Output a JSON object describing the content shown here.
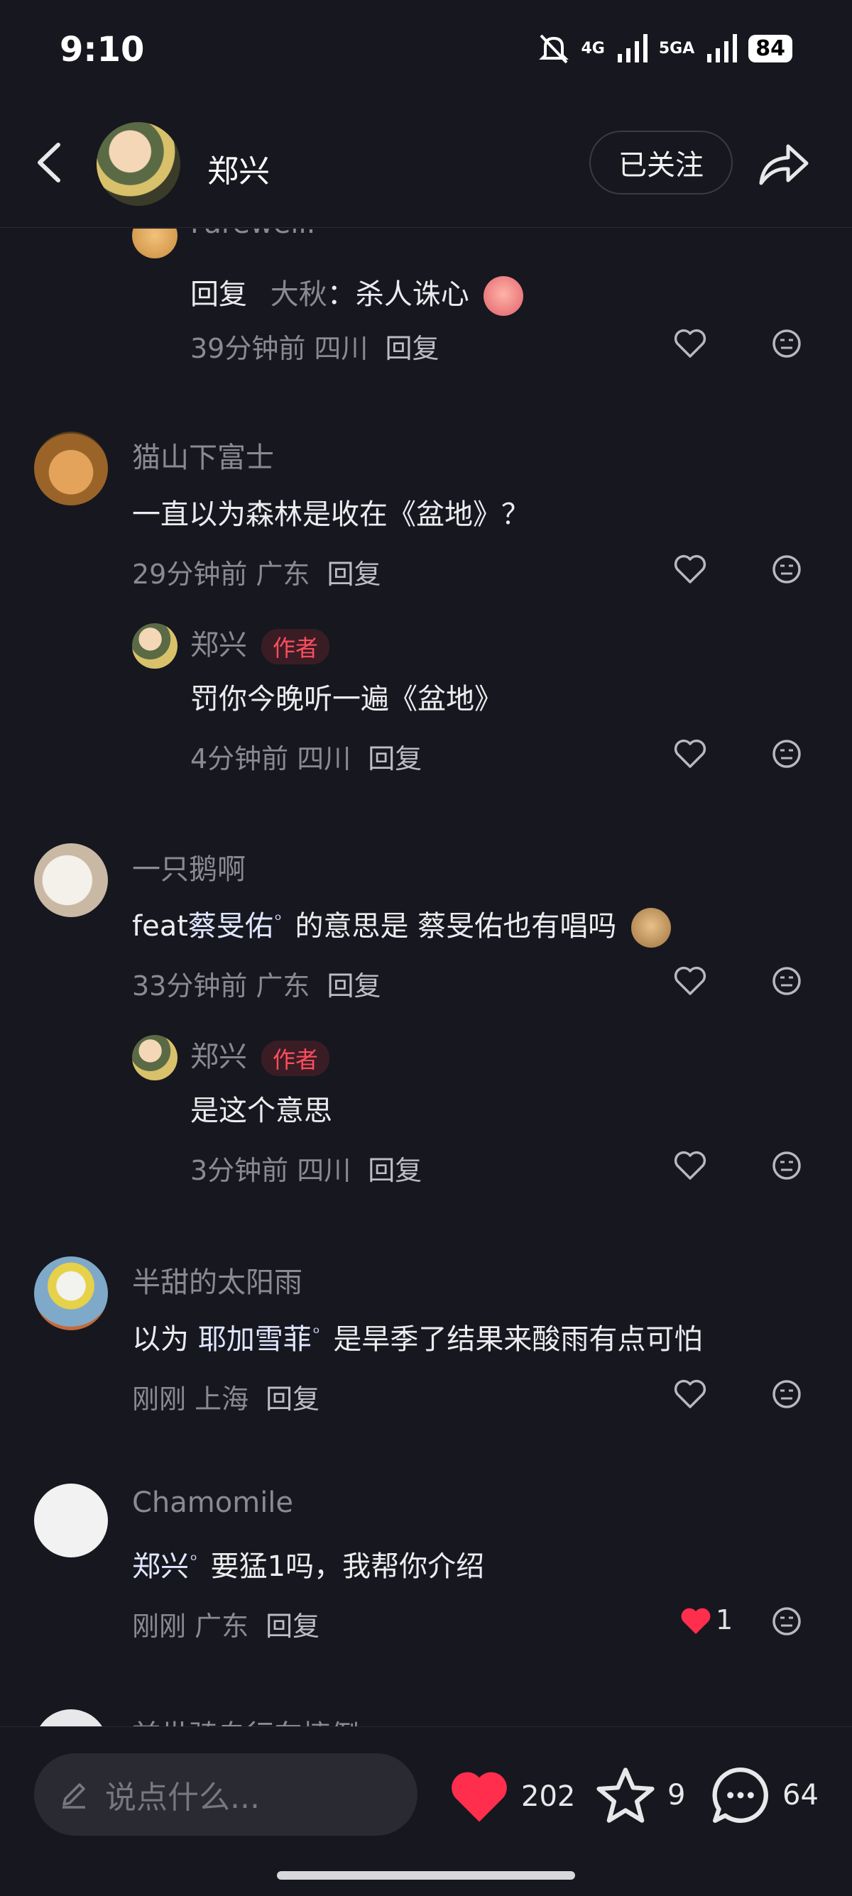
{
  "status_bar": {
    "time": "9:10",
    "network_1": "4G",
    "network_2": "5GA",
    "battery": "84"
  },
  "header": {
    "author_name": "郑兴",
    "follow_label": "已关注",
    "icons": [
      "back-arrow-icon",
      "share-icon"
    ]
  },
  "comments": {
    "c0": {
      "username": "Farewell.",
      "reply_prefix": "回复",
      "reply_to": "大秋",
      "text": "：杀人诛心",
      "meta": "39分钟前 四川",
      "reply_label": "回复"
    },
    "c1": {
      "username": "猫山下富士",
      "text": "一直以为森林是收在《盆地》？",
      "meta": "29分钟前 广东",
      "reply_label": "回复"
    },
    "c1r": {
      "username": "郑兴",
      "tag": "作者",
      "text": "罚你今晚听一遍《盆地》",
      "meta": "4分钟前 四川",
      "reply_label": "回复"
    },
    "c2": {
      "username": "一只鹅啊",
      "text_pre": "feat",
      "link": "蔡旻佑",
      "text_post": " 的意思是 蔡旻佑也有唱吗",
      "meta": "33分钟前 广东",
      "reply_label": "回复"
    },
    "c2r": {
      "username": "郑兴",
      "tag": "作者",
      "text": "是这个意思",
      "meta": "3分钟前 四川",
      "reply_label": "回复"
    },
    "c3": {
      "username": "半甜的太阳雨",
      "text_pre": "以为 ",
      "link": "耶加雪菲",
      "text_post": " 是旱季了结果来酸雨有点可怕",
      "meta": "刚刚 上海",
      "reply_label": "回复"
    },
    "c4": {
      "username": "Chamomile",
      "link": "郑兴",
      "text_post": " 要猛1吗，我帮你介绍",
      "meta": "刚刚 广东",
      "reply_label": "回复",
      "likes": "1"
    },
    "c5": {
      "username": "前世骑自行车摔倒"
    }
  },
  "bottom_bar": {
    "input_placeholder": "说点什么...",
    "like_count": "202",
    "star_count": "9",
    "comment_count": "64"
  },
  "colors": {
    "background": "#17171f",
    "author_tag": "#ff4d5e",
    "like_red": "#ff2e4d"
  }
}
